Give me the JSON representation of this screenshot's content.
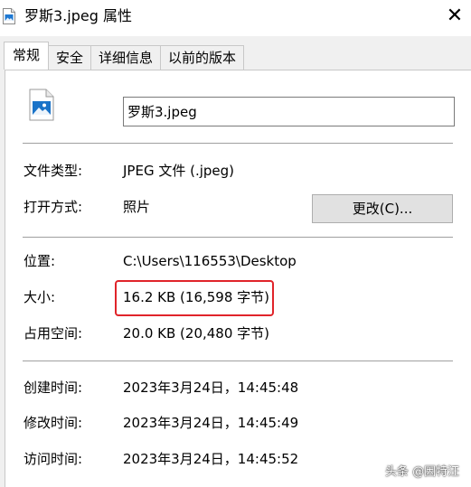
{
  "window": {
    "title": "罗斯3.jpeg 属性",
    "close_glyph": "✕"
  },
  "tabs": [
    {
      "label": "常规",
      "active": true
    },
    {
      "label": "安全",
      "active": false
    },
    {
      "label": "详细信息",
      "active": false
    },
    {
      "label": "以前的版本",
      "active": false
    }
  ],
  "general": {
    "file_name": "罗斯3.jpeg",
    "file_type_label": "文件类型:",
    "file_type_value": "JPEG 文件 (.jpeg)",
    "open_with_label": "打开方式:",
    "open_with_value": "照片",
    "change_button": "更改(C)...",
    "location_label": "位置:",
    "location_value": "C:\\Users\\116553\\Desktop",
    "size_label": "大小:",
    "size_value": "16.2 KB (16,598 字节)",
    "size_on_disk_label": "占用空间:",
    "size_on_disk_value": "20.0 KB (20,480 字节)",
    "created_label": "创建时间:",
    "created_value": "2023年3月24日，14:45:48",
    "modified_label": "修改时间:",
    "modified_value": "2023年3月24日，14:45:49",
    "accessed_label": "访问时间:",
    "accessed_value": "2023年3月24日，14:45:52"
  },
  "watermark": "头条 @因特汪",
  "colors": {
    "highlight": "#e0242a",
    "panel_bg": "#ffffff",
    "window_bg": "#f0f0f0",
    "button_bg": "#e1e1e1"
  },
  "icons": {
    "title_icon": "image-file-icon",
    "file_icon": "image-file-icon"
  }
}
